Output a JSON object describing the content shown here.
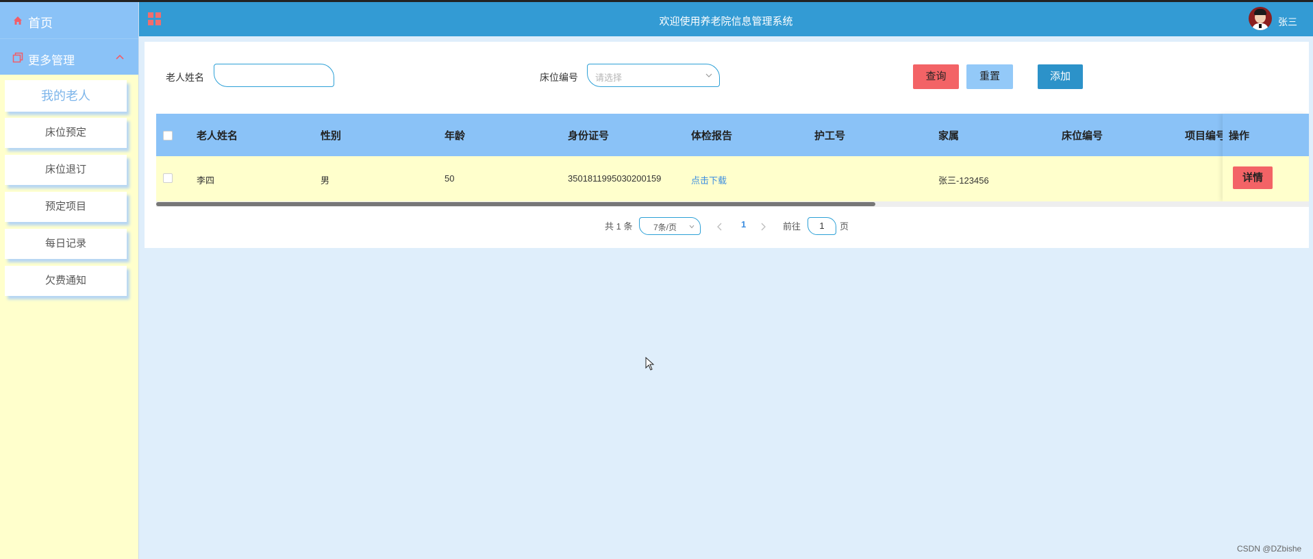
{
  "sidebar": {
    "home_label": "首页",
    "more_label": "更多管理",
    "items": [
      {
        "label": "我的老人",
        "active": true
      },
      {
        "label": "床位预定",
        "active": false
      },
      {
        "label": "床位退订",
        "active": false
      },
      {
        "label": "预定项目",
        "active": false
      },
      {
        "label": "每日记录",
        "active": false
      },
      {
        "label": "欠费通知",
        "active": false
      }
    ]
  },
  "header": {
    "title": "欢迎使用养老院信息管理系统",
    "username": "张三"
  },
  "filters": {
    "name_label": "老人姓名",
    "name_value": "",
    "bed_label": "床位编号",
    "bed_placeholder": "请选择"
  },
  "buttons": {
    "query": "查询",
    "reset": "重置",
    "add": "添加"
  },
  "table": {
    "columns": [
      "老人姓名",
      "性别",
      "年龄",
      "身份证号",
      "体检报告",
      "护工号",
      "家属",
      "床位编号",
      "项目编号",
      "操作"
    ],
    "rows": [
      {
        "name": "李四",
        "gender": "男",
        "age": "50",
        "id_number": "350181199503020015​9",
        "report": "点击下载",
        "nurse_no": "",
        "family": "张三-123456",
        "bed_no": "",
        "project_no": "",
        "action": "详情"
      }
    ]
  },
  "pagination": {
    "total": "共 1 条",
    "page_size": "7条/页",
    "current_page": "1",
    "goto_label": "前往",
    "goto_value": "1",
    "page_suffix": "页"
  },
  "watermark": "CSDN @DZbishe",
  "colors": {
    "header_bg": "#339bd4",
    "sidebar_bg": "#ffffcc",
    "menu_bg": "#8ac2f7",
    "danger": "#f36366",
    "primary": "#2c92c9"
  }
}
